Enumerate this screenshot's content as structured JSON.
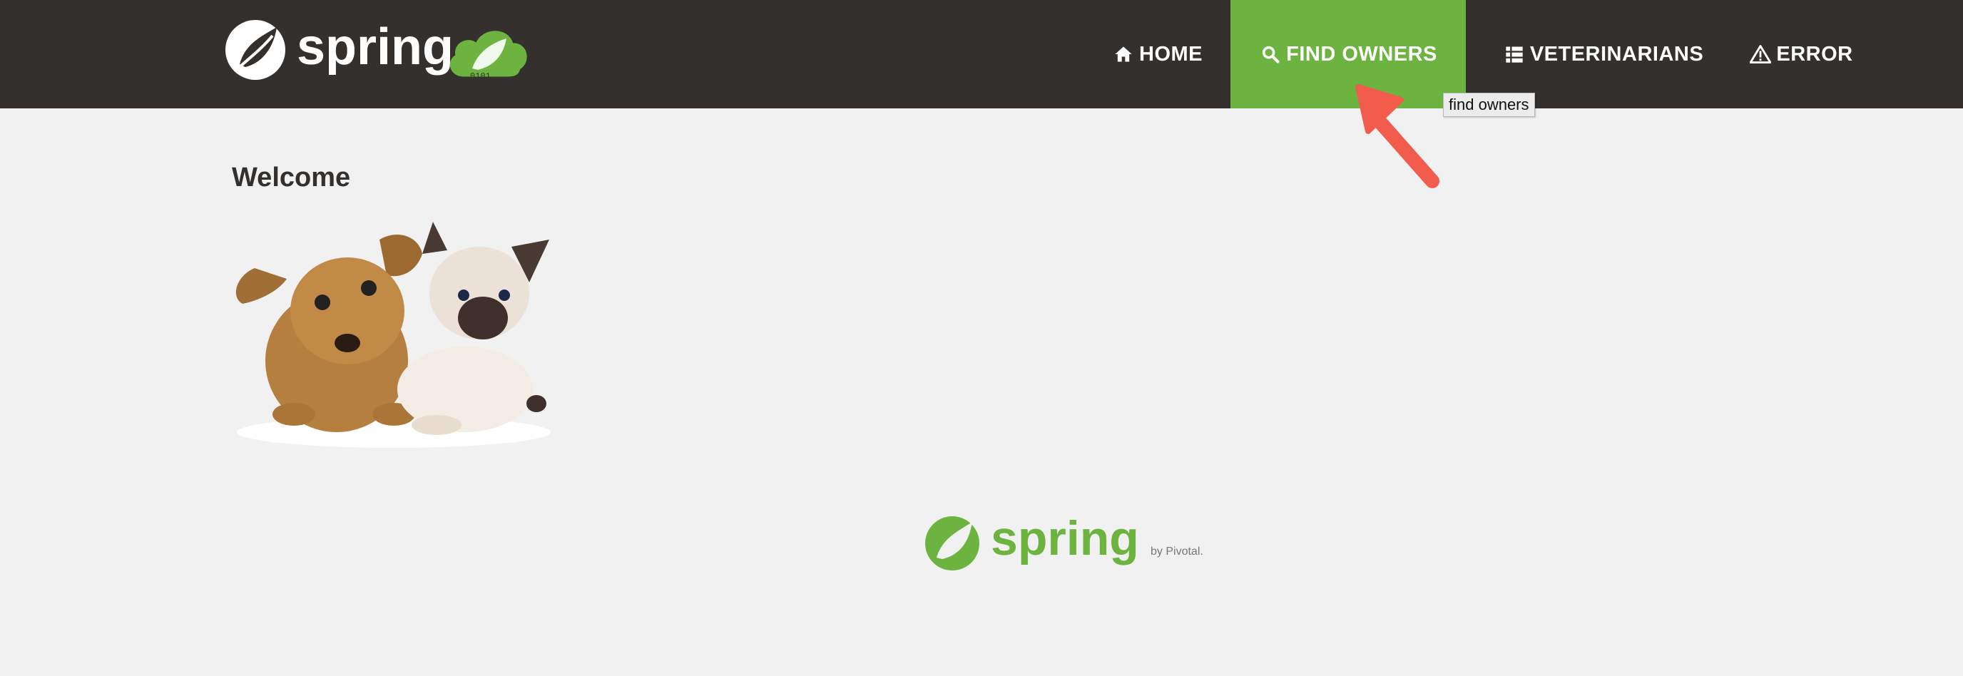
{
  "nav": {
    "items": [
      {
        "label": "HOME",
        "icon": "home-icon",
        "active": false
      },
      {
        "label": "FIND OWNERS",
        "icon": "search-icon",
        "active": true
      },
      {
        "label": "VETERINARIANS",
        "icon": "list-icon",
        "active": false
      },
      {
        "label": "ERROR",
        "icon": "warning-icon",
        "active": false
      }
    ],
    "tooltip": "find owners"
  },
  "brand": {
    "logo_text": "spring",
    "badge_text": "0101"
  },
  "main": {
    "title": "Welcome",
    "image": "pets-image"
  },
  "footer": {
    "logo_text": "spring",
    "byline": "by Pivotal."
  },
  "colors": {
    "navbar": "#34302d",
    "accent": "#6db33f",
    "background": "#f1f1f1",
    "pointer_arrow": "#f25c4d"
  }
}
